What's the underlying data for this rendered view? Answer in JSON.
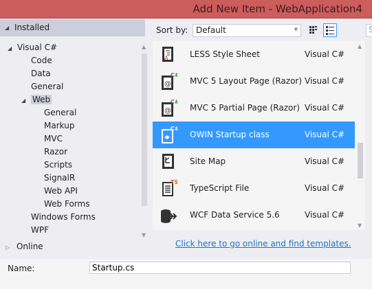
{
  "window": {
    "title": "Add New Item - WebApplication4"
  },
  "left": {
    "installed_label": "Installed",
    "tree": [
      {
        "label": "Visual C#",
        "level": 0,
        "expanded": true
      },
      {
        "label": "Code",
        "level": 1
      },
      {
        "label": "Data",
        "level": 1
      },
      {
        "label": "General",
        "level": 1
      },
      {
        "label": "Web",
        "level": 1,
        "expanded": true,
        "selected": true
      },
      {
        "label": "General",
        "level": 2
      },
      {
        "label": "Markup",
        "level": 2
      },
      {
        "label": "MVC",
        "level": 2
      },
      {
        "label": "Razor",
        "level": 2
      },
      {
        "label": "Scripts",
        "level": 2
      },
      {
        "label": "SignalR",
        "level": 2
      },
      {
        "label": "Web API",
        "level": 2
      },
      {
        "label": "Web Forms",
        "level": 2
      },
      {
        "label": "Windows Forms",
        "level": 1
      },
      {
        "label": "WPF",
        "level": 1
      }
    ],
    "online_label": "Online"
  },
  "toolbar": {
    "sort_label": "Sort by:",
    "sort_value": "Default",
    "search_placeholder": "S"
  },
  "items": [
    {
      "name": "LESS Style Sheet",
      "language": "Visual C#",
      "icon": "less-file-icon"
    },
    {
      "name": "MVC 5 Layout Page (Razor)",
      "language": "Visual C#",
      "icon": "razor-page-icon",
      "badge": "C#"
    },
    {
      "name": "MVC 5 Partial Page (Razor)",
      "language": "Visual C#",
      "icon": "razor-page-icon",
      "badge": "C#"
    },
    {
      "name": "OWIN Startup class",
      "language": "Visual C#",
      "icon": "owin-class-icon",
      "badge": "C#",
      "selected": true
    },
    {
      "name": "Site Map",
      "language": "Visual C#",
      "icon": "sitemap-icon"
    },
    {
      "name": "TypeScript File",
      "language": "Visual C#",
      "icon": "typescript-file-icon",
      "badge": "TS"
    },
    {
      "name": "WCF Data Service 5.6",
      "language": "Visual C#",
      "icon": "wcf-service-icon"
    }
  ],
  "online_link": "Click here to go online and find templates.",
  "form": {
    "name_label": "Name:",
    "name_value": "Startup.cs"
  },
  "colors": {
    "title_bar": "#cd5c5c",
    "selection": "#3399ff",
    "csharp_badge": "#388a34",
    "ts_badge": "#e05d1c",
    "link": "#1e72c8"
  }
}
